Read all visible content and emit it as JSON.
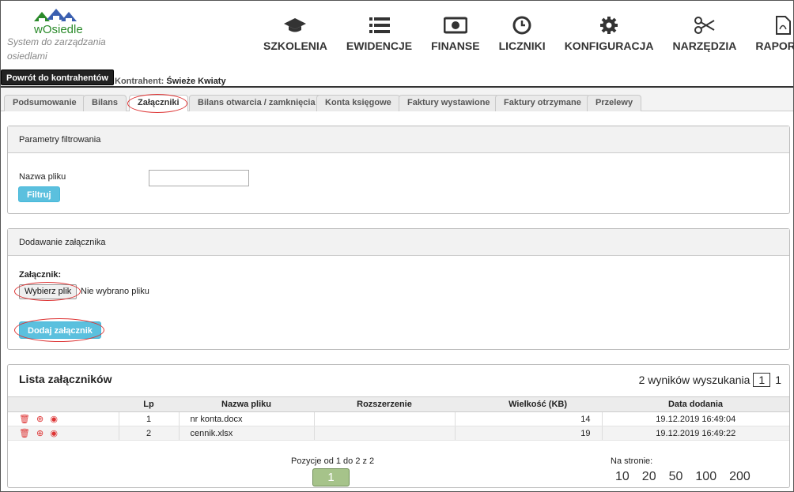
{
  "brand": {
    "logo_text": "wOsiedle",
    "tagline": "System do zarządzania osiedlami"
  },
  "topnav": [
    {
      "label": "SZKOLENIA",
      "icon": "graduation-cap-icon"
    },
    {
      "label": "EWIDENCJE",
      "icon": "list-icon"
    },
    {
      "label": "FINANSE",
      "icon": "money-icon"
    },
    {
      "label": "LICZNIKI",
      "icon": "clock-icon"
    },
    {
      "label": "KONFIGURACJA",
      "icon": "gear-icon"
    },
    {
      "label": "NARZĘDZIA",
      "icon": "scissors-icon"
    },
    {
      "label": "RAPORTY",
      "icon": "pdf-file-icon"
    }
  ],
  "back_button": "Powrót do kontrahentów",
  "contractor": {
    "label": "Kontrahent:",
    "value": "Świeże Kwiaty"
  },
  "tabs": [
    {
      "label": "Podsumowanie"
    },
    {
      "label": "Bilans"
    },
    {
      "label": "Załączniki",
      "active": true
    },
    {
      "label": "Bilans otwarcia / zamknięcia"
    },
    {
      "label": "Konta księgowe"
    },
    {
      "label": "Faktury wystawione"
    },
    {
      "label": "Faktury otrzymane"
    },
    {
      "label": "Przelewy"
    }
  ],
  "filter": {
    "title": "Parametry filtrowania",
    "field_label": "Nazwa pliku",
    "field_value": "",
    "button": "Filtruj"
  },
  "upload": {
    "title": "Dodawanie załącznika",
    "label": "Załącznik:",
    "choose_button": "Wybierz plik",
    "no_file": "Nie wybrano pliku",
    "add_button": "Dodaj załącznik"
  },
  "list": {
    "title": "Lista załączników",
    "results_text": "2 wyników wyszukania",
    "current_page": "1",
    "total_pages": "1",
    "columns": [
      "Lp",
      "Nazwa pliku",
      "Rozszerzenie",
      "Wielkość (KB)",
      "Data dodania"
    ],
    "rows": [
      {
        "lp": "1",
        "name": "nr konta.docx",
        "ext": "",
        "size": "14",
        "date": "19.12.2019 16:49:04"
      },
      {
        "lp": "2",
        "name": "cennik.xlsx",
        "ext": "",
        "size": "19",
        "date": "19.12.2019 16:49:22"
      }
    ],
    "position_info": "Pozycje od 1 do 2 z 2",
    "pager_current": "1",
    "per_page_label": "Na stronie:",
    "per_page_options": [
      "10",
      "20",
      "50",
      "100",
      "200"
    ]
  },
  "colors": {
    "accent": "#5bc0de",
    "annotation": "#dd3333",
    "pager": "#a6c38a",
    "brand_green": "#2a8a2a"
  }
}
